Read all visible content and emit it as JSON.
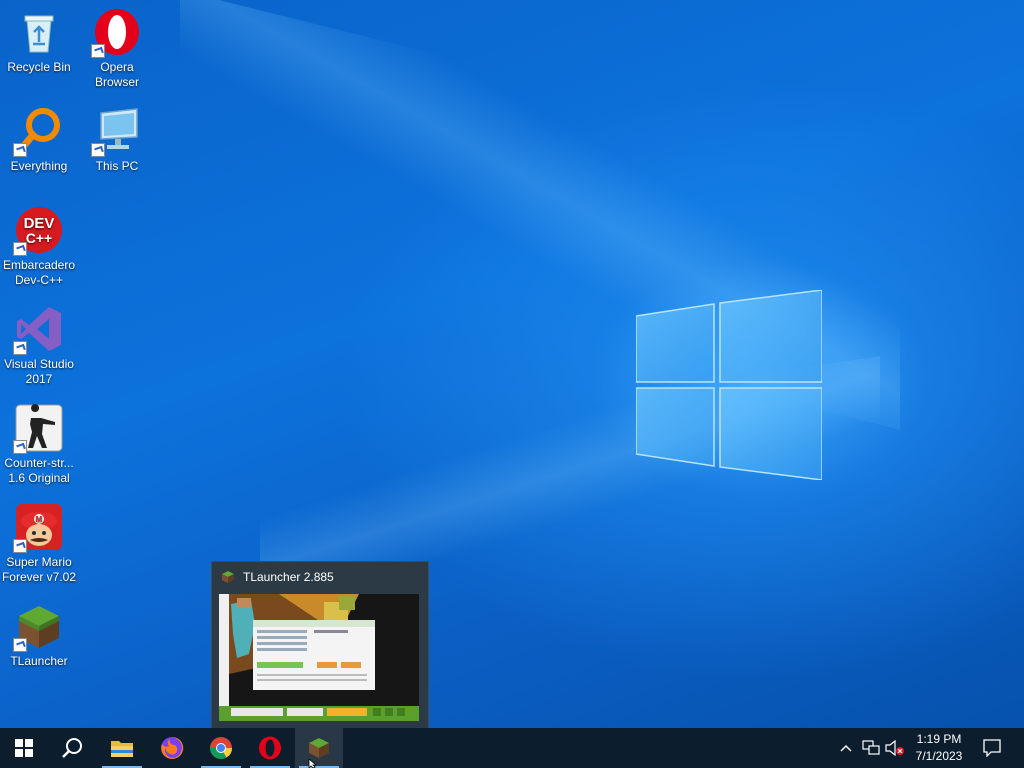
{
  "desktop": {
    "icons": [
      {
        "label": "Recycle Bin"
      },
      {
        "label": "Opera\nBrowser"
      },
      {
        "label": "Everything"
      },
      {
        "label": "This PC"
      },
      {
        "label": "Embarcadero\nDev-C++"
      },
      {
        "label": "Visual Studio\n2017"
      },
      {
        "label": "Counter-str...\n1.6 Original"
      },
      {
        "label": "Super Mario\nForever v7.02"
      },
      {
        "label": "TLauncher"
      }
    ]
  },
  "preview": {
    "title": "TLauncher 2.885"
  },
  "taskbar": {
    "apps": [
      "start",
      "search",
      "file-explorer",
      "firefox",
      "chrome",
      "opera",
      "tlauncher"
    ],
    "active": "tlauncher"
  },
  "clock": {
    "time": "1:19 PM",
    "date": "7/1/2023"
  },
  "colors": {
    "taskbar": "#0c1d2e",
    "accent": "#7ab8ee"
  }
}
